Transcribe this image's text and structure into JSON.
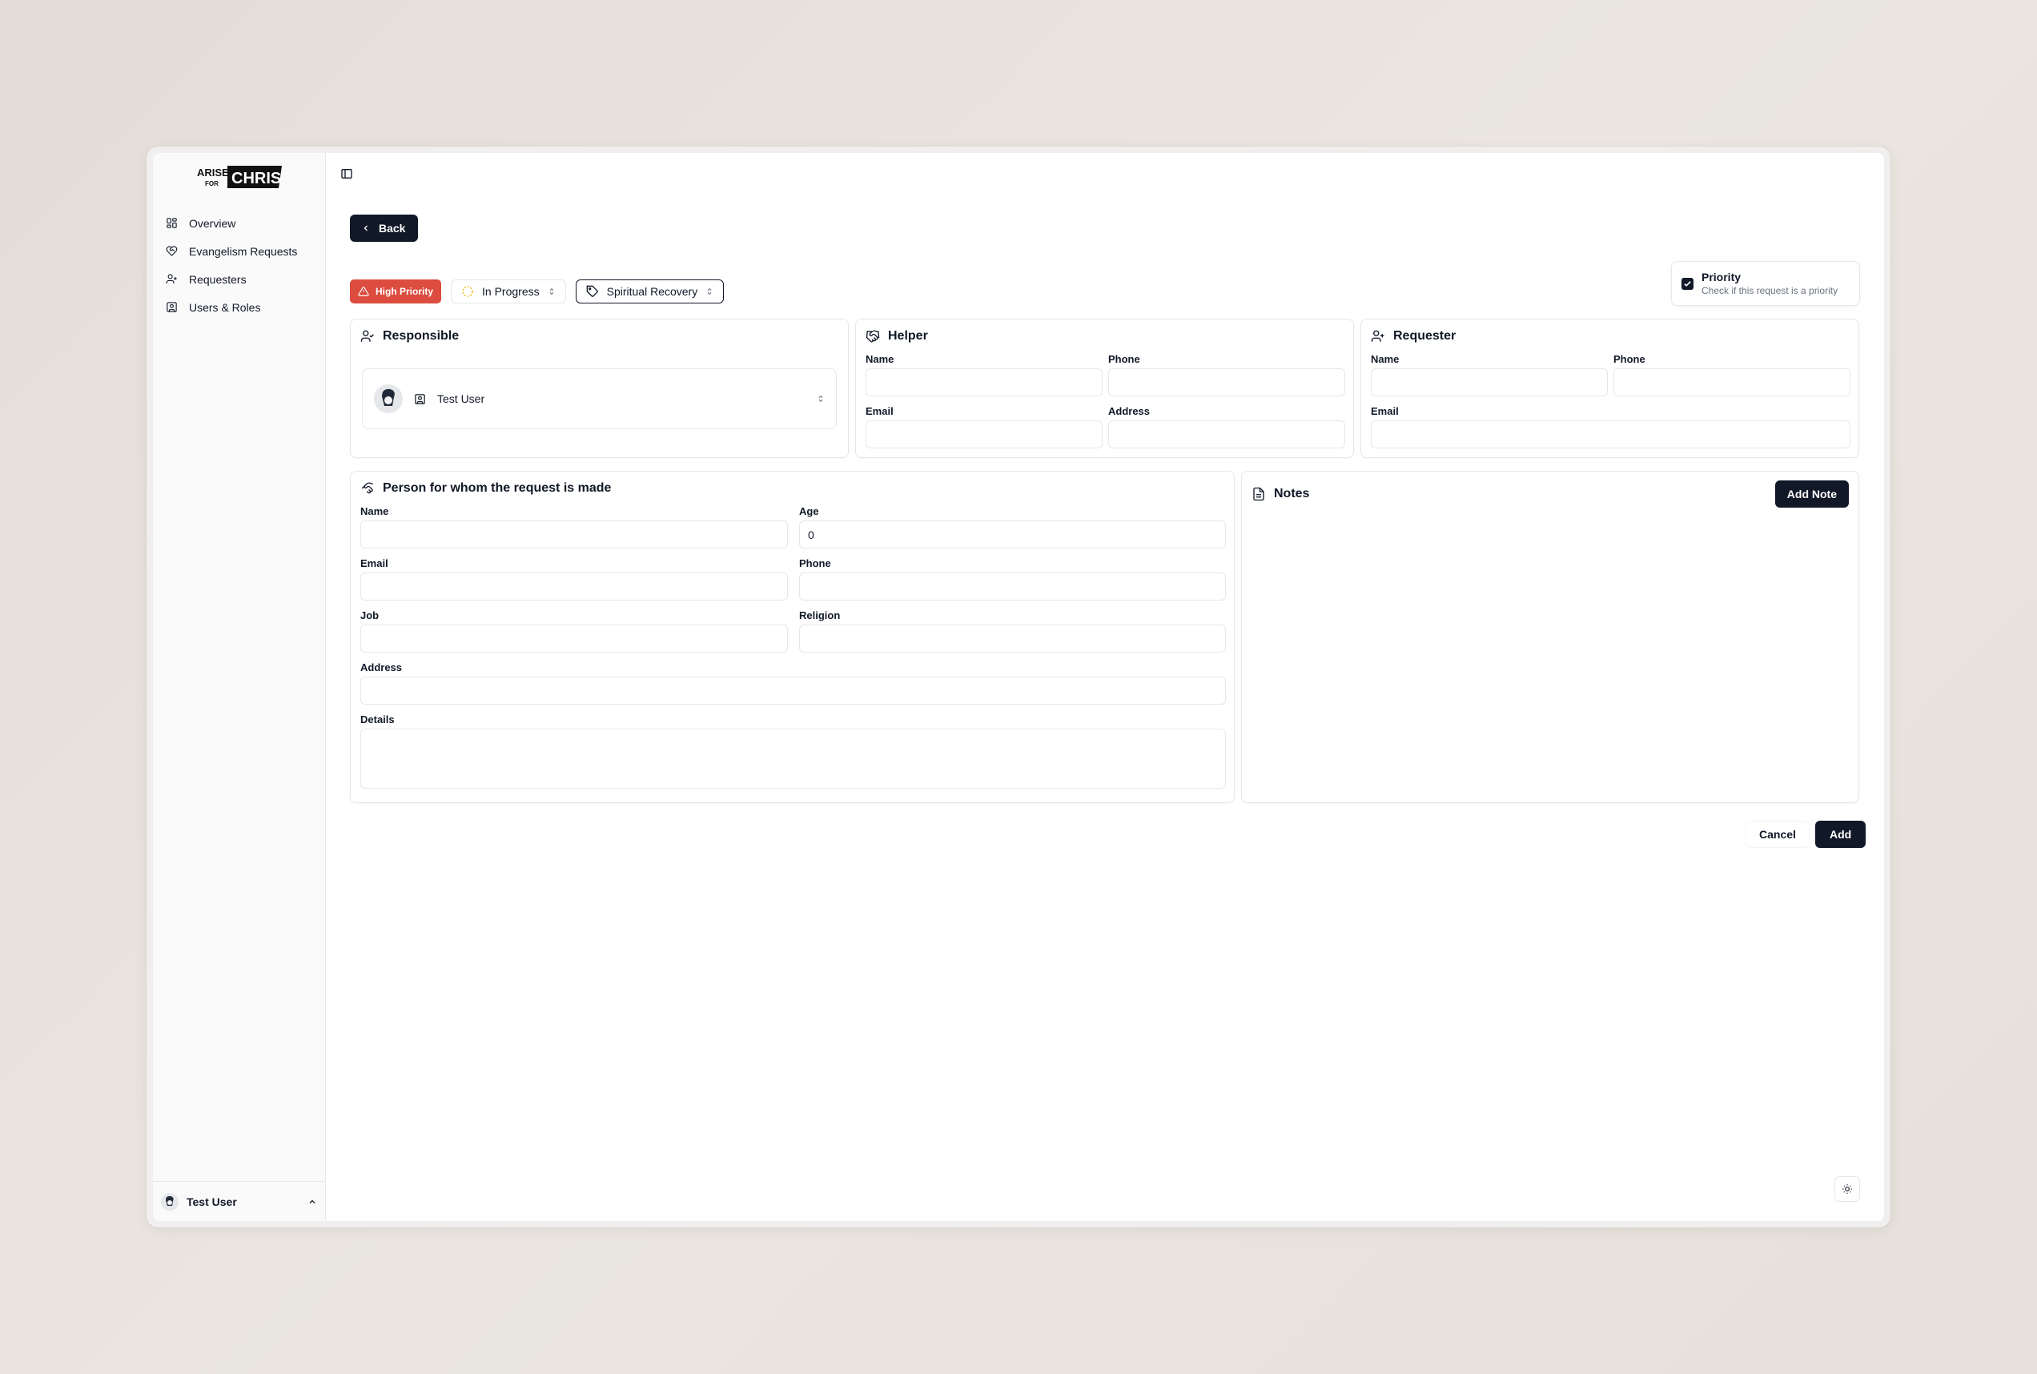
{
  "app": {
    "logo_text_top": "ARISE",
    "logo_text_small": "FOR",
    "logo_text_brand": "CHRIST"
  },
  "sidebar": {
    "items": [
      {
        "label": "Overview",
        "icon": "grid-icon"
      },
      {
        "label": "Evangelism Requests",
        "icon": "heart-handshake-icon"
      },
      {
        "label": "Requesters",
        "icon": "user-plus-icon"
      },
      {
        "label": "Users & Roles",
        "icon": "contact-icon"
      }
    ],
    "footer_user": "Test User"
  },
  "header": {
    "back_label": "Back"
  },
  "toolbar": {
    "priority_badge": "High Priority",
    "status": "In Progress",
    "category": "Spiritual Recovery"
  },
  "priority": {
    "title": "Priority",
    "description": "Check if this request is a priority",
    "checked": true
  },
  "responsible": {
    "title": "Responsible",
    "user": "Test User"
  },
  "helper": {
    "title": "Helper",
    "name_label": "Name",
    "phone_label": "Phone",
    "email_label": "Email",
    "address_label": "Address",
    "name": "",
    "phone": "",
    "email": "",
    "address": ""
  },
  "requester": {
    "title": "Requester",
    "name_label": "Name",
    "phone_label": "Phone",
    "email_label": "Email",
    "name": "",
    "phone": "",
    "email": ""
  },
  "person": {
    "title": "Person for whom the request is made",
    "name_label": "Name",
    "age_label": "Age",
    "email_label": "Email",
    "phone_label": "Phone",
    "job_label": "Job",
    "religion_label": "Religion",
    "address_label": "Address",
    "details_label": "Details",
    "name": "",
    "age": "0",
    "email": "",
    "phone": "",
    "job": "",
    "religion": "",
    "address": "",
    "details": ""
  },
  "notes": {
    "title": "Notes",
    "add_label": "Add Note"
  },
  "actions": {
    "cancel_label": "Cancel",
    "add_label": "Add"
  },
  "colors": {
    "primary": "#111827",
    "danger": "#dc4c3f"
  }
}
